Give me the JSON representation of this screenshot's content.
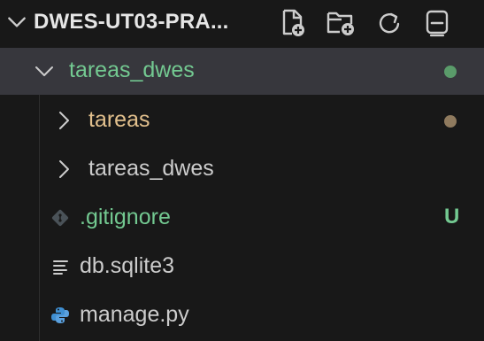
{
  "header": {
    "title": "DWES-UT03-PRA...",
    "actions": [
      {
        "icon": "new-file-icon"
      },
      {
        "icon": "new-folder-icon"
      },
      {
        "icon": "refresh-icon"
      },
      {
        "icon": "collapse-all-icon"
      }
    ]
  },
  "tree": {
    "root": {
      "label": "tareas_dwes",
      "color": "#73c991",
      "dot_color": "#5a9b6a"
    },
    "items": [
      {
        "label": "tareas",
        "color": "#e2c08d",
        "dot_color": "#8f7a5e"
      },
      {
        "label": "tareas_dwes",
        "color": "#cccccc"
      },
      {
        "label": ".gitignore",
        "color": "#73c991",
        "badge": "U",
        "badge_color": "#73c991"
      },
      {
        "label": "db.sqlite3",
        "color": "#cccccc"
      },
      {
        "label": "manage.py",
        "color": "#cccccc"
      }
    ]
  }
}
